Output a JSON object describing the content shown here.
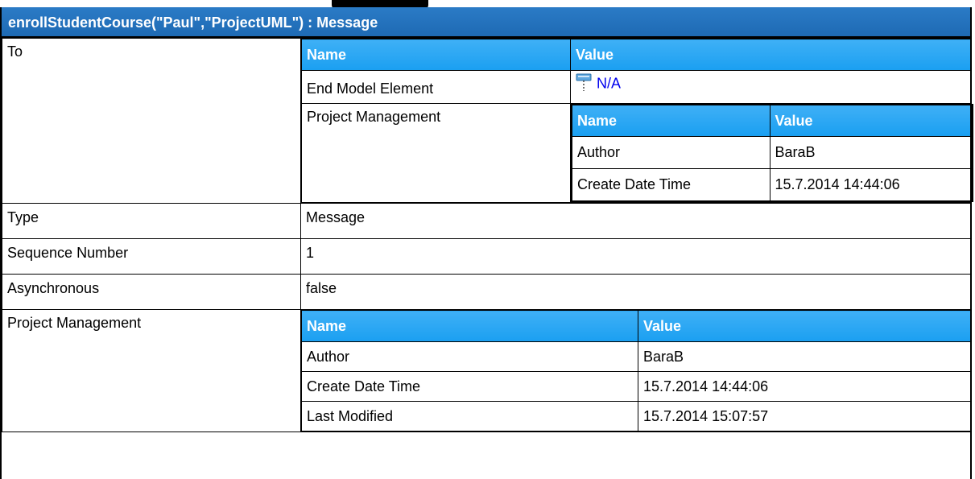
{
  "title": "enrollStudentCourse(\"Paul\",\"ProjectUML\") : Message",
  "to": {
    "label": "To",
    "header": {
      "name": "Name",
      "value": "Value"
    },
    "end_model_element": {
      "label": "End Model Element",
      "value": "N/A",
      "icon": "message-end-icon"
    },
    "project_management": {
      "label": "Project Management",
      "header": {
        "name": "Name",
        "value": "Value"
      },
      "rows": [
        {
          "name": "Author",
          "value": "BaraB"
        },
        {
          "name": "Create Date Time",
          "value": "15.7.2014 14:44:06"
        }
      ]
    }
  },
  "type": {
    "label": "Type",
    "value": "Message"
  },
  "sequence_number": {
    "label": "Sequence Number",
    "value": "1"
  },
  "asynchronous": {
    "label": "Asynchronous",
    "value": "false"
  },
  "project_management": {
    "label": "Project Management",
    "header": {
      "name": "Name",
      "value": "Value"
    },
    "rows": [
      {
        "name": "Author",
        "value": "BaraB"
      },
      {
        "name": "Create Date Time",
        "value": "15.7.2014 14:44:06"
      },
      {
        "name": "Last Modified",
        "value": "15.7.2014 15:07:57"
      }
    ]
  },
  "colors": {
    "title_bar": "#1e6ab4",
    "header": "#1a9ff1",
    "link": "#0000ee"
  }
}
